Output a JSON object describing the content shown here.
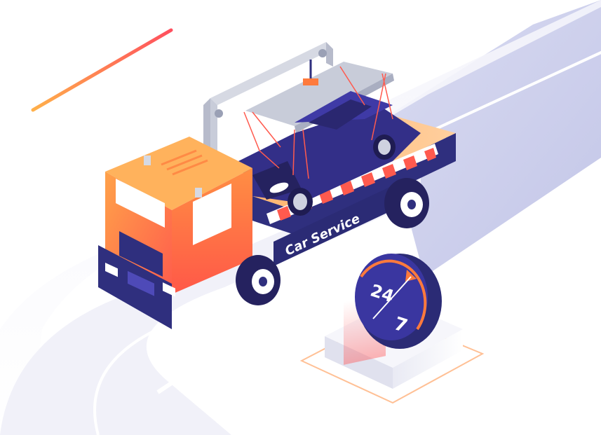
{
  "illustration": {
    "truck_side_text": "Car Service",
    "badge_top": "24",
    "badge_bottom": "7",
    "colors": {
      "road": "#c9ccea",
      "road_shadow": "#e8e9f6",
      "truck_orange": "#ff8a45",
      "truck_red": "#ff5a4e",
      "truck_navy": "#2f2f7e",
      "car_navy": "#332f88",
      "crane_grey": "#c3c7d4",
      "accent_line": "#ff6b3d"
    }
  }
}
